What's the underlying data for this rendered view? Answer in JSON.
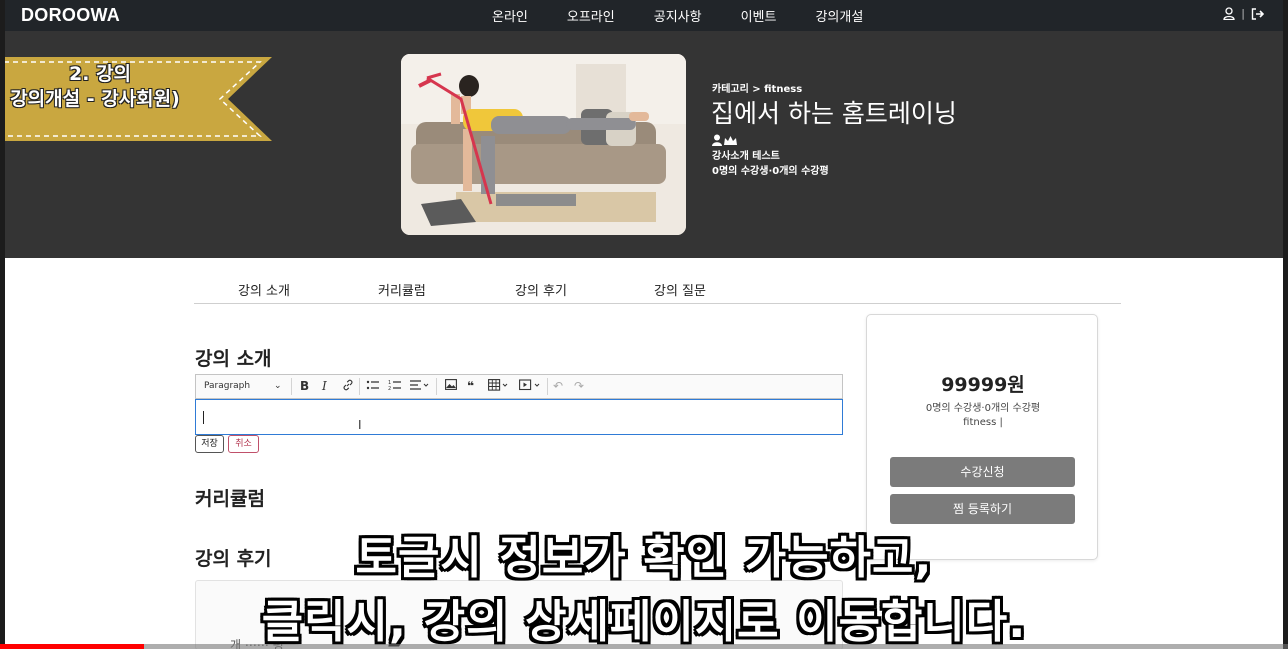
{
  "navbar": {
    "brand": "DOROOWA",
    "links": [
      "온라인",
      "오프라인",
      "공지사항",
      "이벤트",
      "강의개설"
    ],
    "separator": "|"
  },
  "ribbon": {
    "line1": "2. 강의",
    "line2": "강의개설 - 강사회원)"
  },
  "course": {
    "category": "카테고리 > fitness",
    "title": "집에서 하는 홈트레이닝",
    "instructor": "강사소개 테스트",
    "stats": "0명의 수강생·0개의 수강평"
  },
  "tabs": [
    "강의 소개",
    "커리큘럼",
    "강의 후기",
    "강의 질문"
  ],
  "sections": {
    "intro": "강의 소개",
    "curriculum": "커리큘럼",
    "reviews": "강의 후기"
  },
  "editor": {
    "paragraph_select": "Paragraph",
    "save_label": "저장",
    "cancel_label": "취소"
  },
  "review_snippet": "개 ⋯⋯ 평",
  "sidebar": {
    "price": "99999원",
    "stats": "0명의 수강생·0개의 수강평",
    "category": "fitness |",
    "enroll_label": "수강신청",
    "wishlist_label": "찜 등록하기"
  },
  "subtitle": {
    "line1": "토글시 정보가 확인 가능하고,",
    "line2": "클릭시, 강의 상세페이지로 이동합니다."
  },
  "video_progress": 0.112,
  "colors": {
    "navbar": "#212529",
    "hero": "#343434",
    "ribbon": "#c9a740",
    "editor_focus": "#2f7bd6",
    "button": "#7b7b7b",
    "progress": "#ff0000"
  }
}
